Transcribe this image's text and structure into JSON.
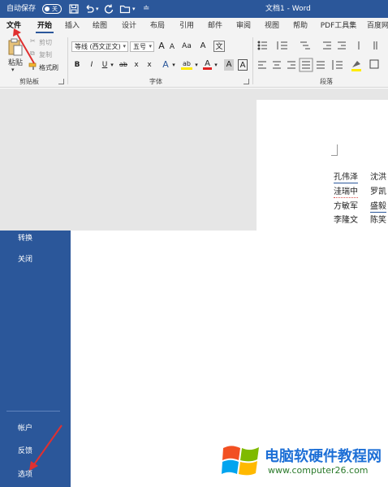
{
  "titlebar": {
    "autosave_label": "自动保存",
    "autosave_state": "关",
    "doc_title": "文档1 - Word",
    "icons": [
      "save-icon",
      "undo-icon",
      "redo-icon",
      "open-folder-icon",
      "customize-icon"
    ]
  },
  "tabs": [
    "文件",
    "开始",
    "插入",
    "绘图",
    "设计",
    "布局",
    "引用",
    "邮件",
    "审阅",
    "视图",
    "帮助",
    "PDF工具集",
    "百度网"
  ],
  "ribbon": {
    "clipboard": {
      "paste": "粘贴",
      "cut": "剪切",
      "copy": "复制",
      "format_painter": "格式刷",
      "group_label": "剪贴板"
    },
    "font": {
      "font_name": "等线 (西文正文)",
      "font_size": "五号",
      "grow": "A",
      "shrink": "A",
      "case": "Aa",
      "clear": "A",
      "wen": "文",
      "bold": "B",
      "italic": "I",
      "underline": "U",
      "strike": "ab",
      "subscript": "x",
      "superscript": "x",
      "effects": "A",
      "highlight": "ab",
      "color": "A",
      "shade": "A",
      "border": "A",
      "group_label": "字体"
    },
    "paragraph": {
      "group_label": "段落"
    }
  },
  "document": {
    "names": [
      [
        "孔伟泽",
        "沈洪"
      ],
      [
        "洼瑞中",
        "罗凯"
      ],
      [
        "方敏军",
        "盛毅"
      ],
      [
        "李隆文",
        "陈笑"
      ]
    ]
  },
  "backstage": {
    "top_items": [
      "转换",
      "关闭"
    ],
    "bottom_items": [
      "帐户",
      "反馈",
      "选项"
    ]
  },
  "watermark": {
    "title": "电脑软硬件教程网",
    "url": "www.computer26.com"
  },
  "colors": {
    "word_blue": "#2b579a",
    "ribbon_bg": "#f3f3f3",
    "arrow_red": "#e03030"
  }
}
